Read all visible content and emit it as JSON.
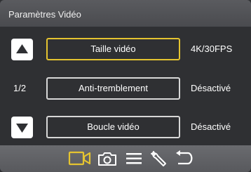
{
  "header": {
    "title": "Paramètres Vidéo"
  },
  "pager": {
    "label": "1/2"
  },
  "settings": [
    {
      "label": "Taille vidéo",
      "value": "4K/30FPS",
      "selected": true
    },
    {
      "label": "Anti-tremblement",
      "value": "Désactivé",
      "selected": false
    },
    {
      "label": "Boucle vidéo",
      "value": "Désactivé",
      "selected": false
    }
  ],
  "toolbar": {
    "items": [
      "video-icon",
      "camera-icon",
      "menu-icon",
      "wrench-icon",
      "back-icon"
    ],
    "active": "video-icon"
  },
  "colors": {
    "accent": "#e5c430",
    "background": "#2f3033",
    "header": "#4f5054",
    "toolbar": "#606165",
    "border": "#d7d7d7"
  }
}
